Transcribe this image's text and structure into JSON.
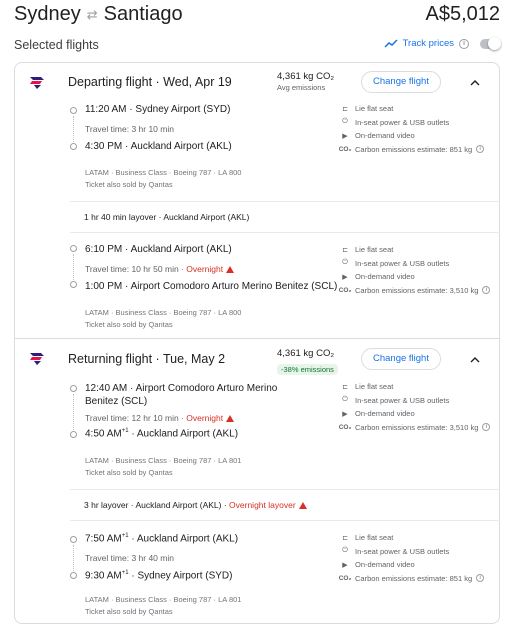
{
  "header": {
    "origin": "Sydney",
    "destination": "Santiago",
    "price": "A$5,012"
  },
  "selected": {
    "title": "Selected flights",
    "track_prices": "Track prices"
  },
  "colors": {
    "accent": "#1a73e8",
    "warning": "#d93025",
    "latam_purple": "#2b1f78",
    "latam_red": "#e8114b"
  },
  "departing": {
    "title": "Departing flight · Wed, Apr 19",
    "co2": "4,361 kg CO₂",
    "co2_note": "Avg emissions",
    "change_label": "Change flight",
    "segments": [
      {
        "dep_time": "11:20 AM",
        "dep_airport": "Sydney Airport (SYD)",
        "travel": "Travel time: 3 hr 10 min",
        "arr_time": "4:30 PM",
        "arr_airport": "Auckland Airport (AKL)",
        "meta1": "LATAM · Business Class · Boeing 787 · LA 800",
        "meta2": "Ticket also sold by Qantas",
        "amenities": [
          "Lie flat seat",
          "In-seat power & USB outlets",
          "On-demand video",
          "Carbon emissions estimate: 851 kg"
        ]
      },
      {
        "dep_time": "6:10 PM",
        "dep_airport": "Auckland Airport (AKL)",
        "travel": "Travel time: 10 hr 50 min",
        "overnight": "Overnight",
        "arr_time": "1:00 PM",
        "arr_airport": "Airport Comodoro Arturo Merino Benitez (SCL)",
        "meta1": "LATAM · Business Class · Boeing 787 · LA 800",
        "meta2": "Ticket also sold by Qantas",
        "amenities": [
          "Lie flat seat",
          "In-seat power & USB outlets",
          "On-demand video",
          "Carbon emissions estimate: 3,510 kg"
        ]
      }
    ],
    "layover": "1 hr 40 min layover · Auckland Airport (AKL)"
  },
  "returning": {
    "title": "Returning flight · Tue, May 2",
    "co2": "4,361 kg CO₂",
    "co2_note": "-38% emissions",
    "change_label": "Change flight",
    "segments": [
      {
        "dep_time": "12:40 AM",
        "dep_airport_1": "Airport Comodoro Arturo Merino",
        "dep_airport_2": "Benitez (SCL)",
        "travel": "Travel time: 12 hr 10 min",
        "overnight": "Overnight",
        "arr_time": "4:50 AM",
        "arr_sup": "+1",
        "arr_airport": "Auckland Airport (AKL)",
        "meta1": "LATAM · Business Class · Boeing 787 · LA 801",
        "meta2": "Ticket also sold by Qantas",
        "amenities": [
          "Lie flat seat",
          "In-seat power & USB outlets",
          "On-demand video",
          "Carbon emissions estimate: 3,510 kg"
        ]
      },
      {
        "dep_time": "7:50 AM",
        "dep_sup": "+1",
        "dep_airport": "Auckland Airport (AKL)",
        "travel": "Travel time: 3 hr 40 min",
        "arr_time": "9:30 AM",
        "arr_sup": "+1",
        "arr_airport": "Sydney Airport (SYD)",
        "meta1": "LATAM · Business Class · Boeing 787 · LA 801",
        "meta2": "Ticket also sold by Qantas",
        "amenities": [
          "Lie flat seat",
          "In-seat power & USB outlets",
          "On-demand video",
          "Carbon emissions estimate: 851 kg"
        ]
      }
    ],
    "layover": "3 hr layover · Auckland Airport (AKL) · ",
    "layover_overnight": "Overnight layover"
  }
}
